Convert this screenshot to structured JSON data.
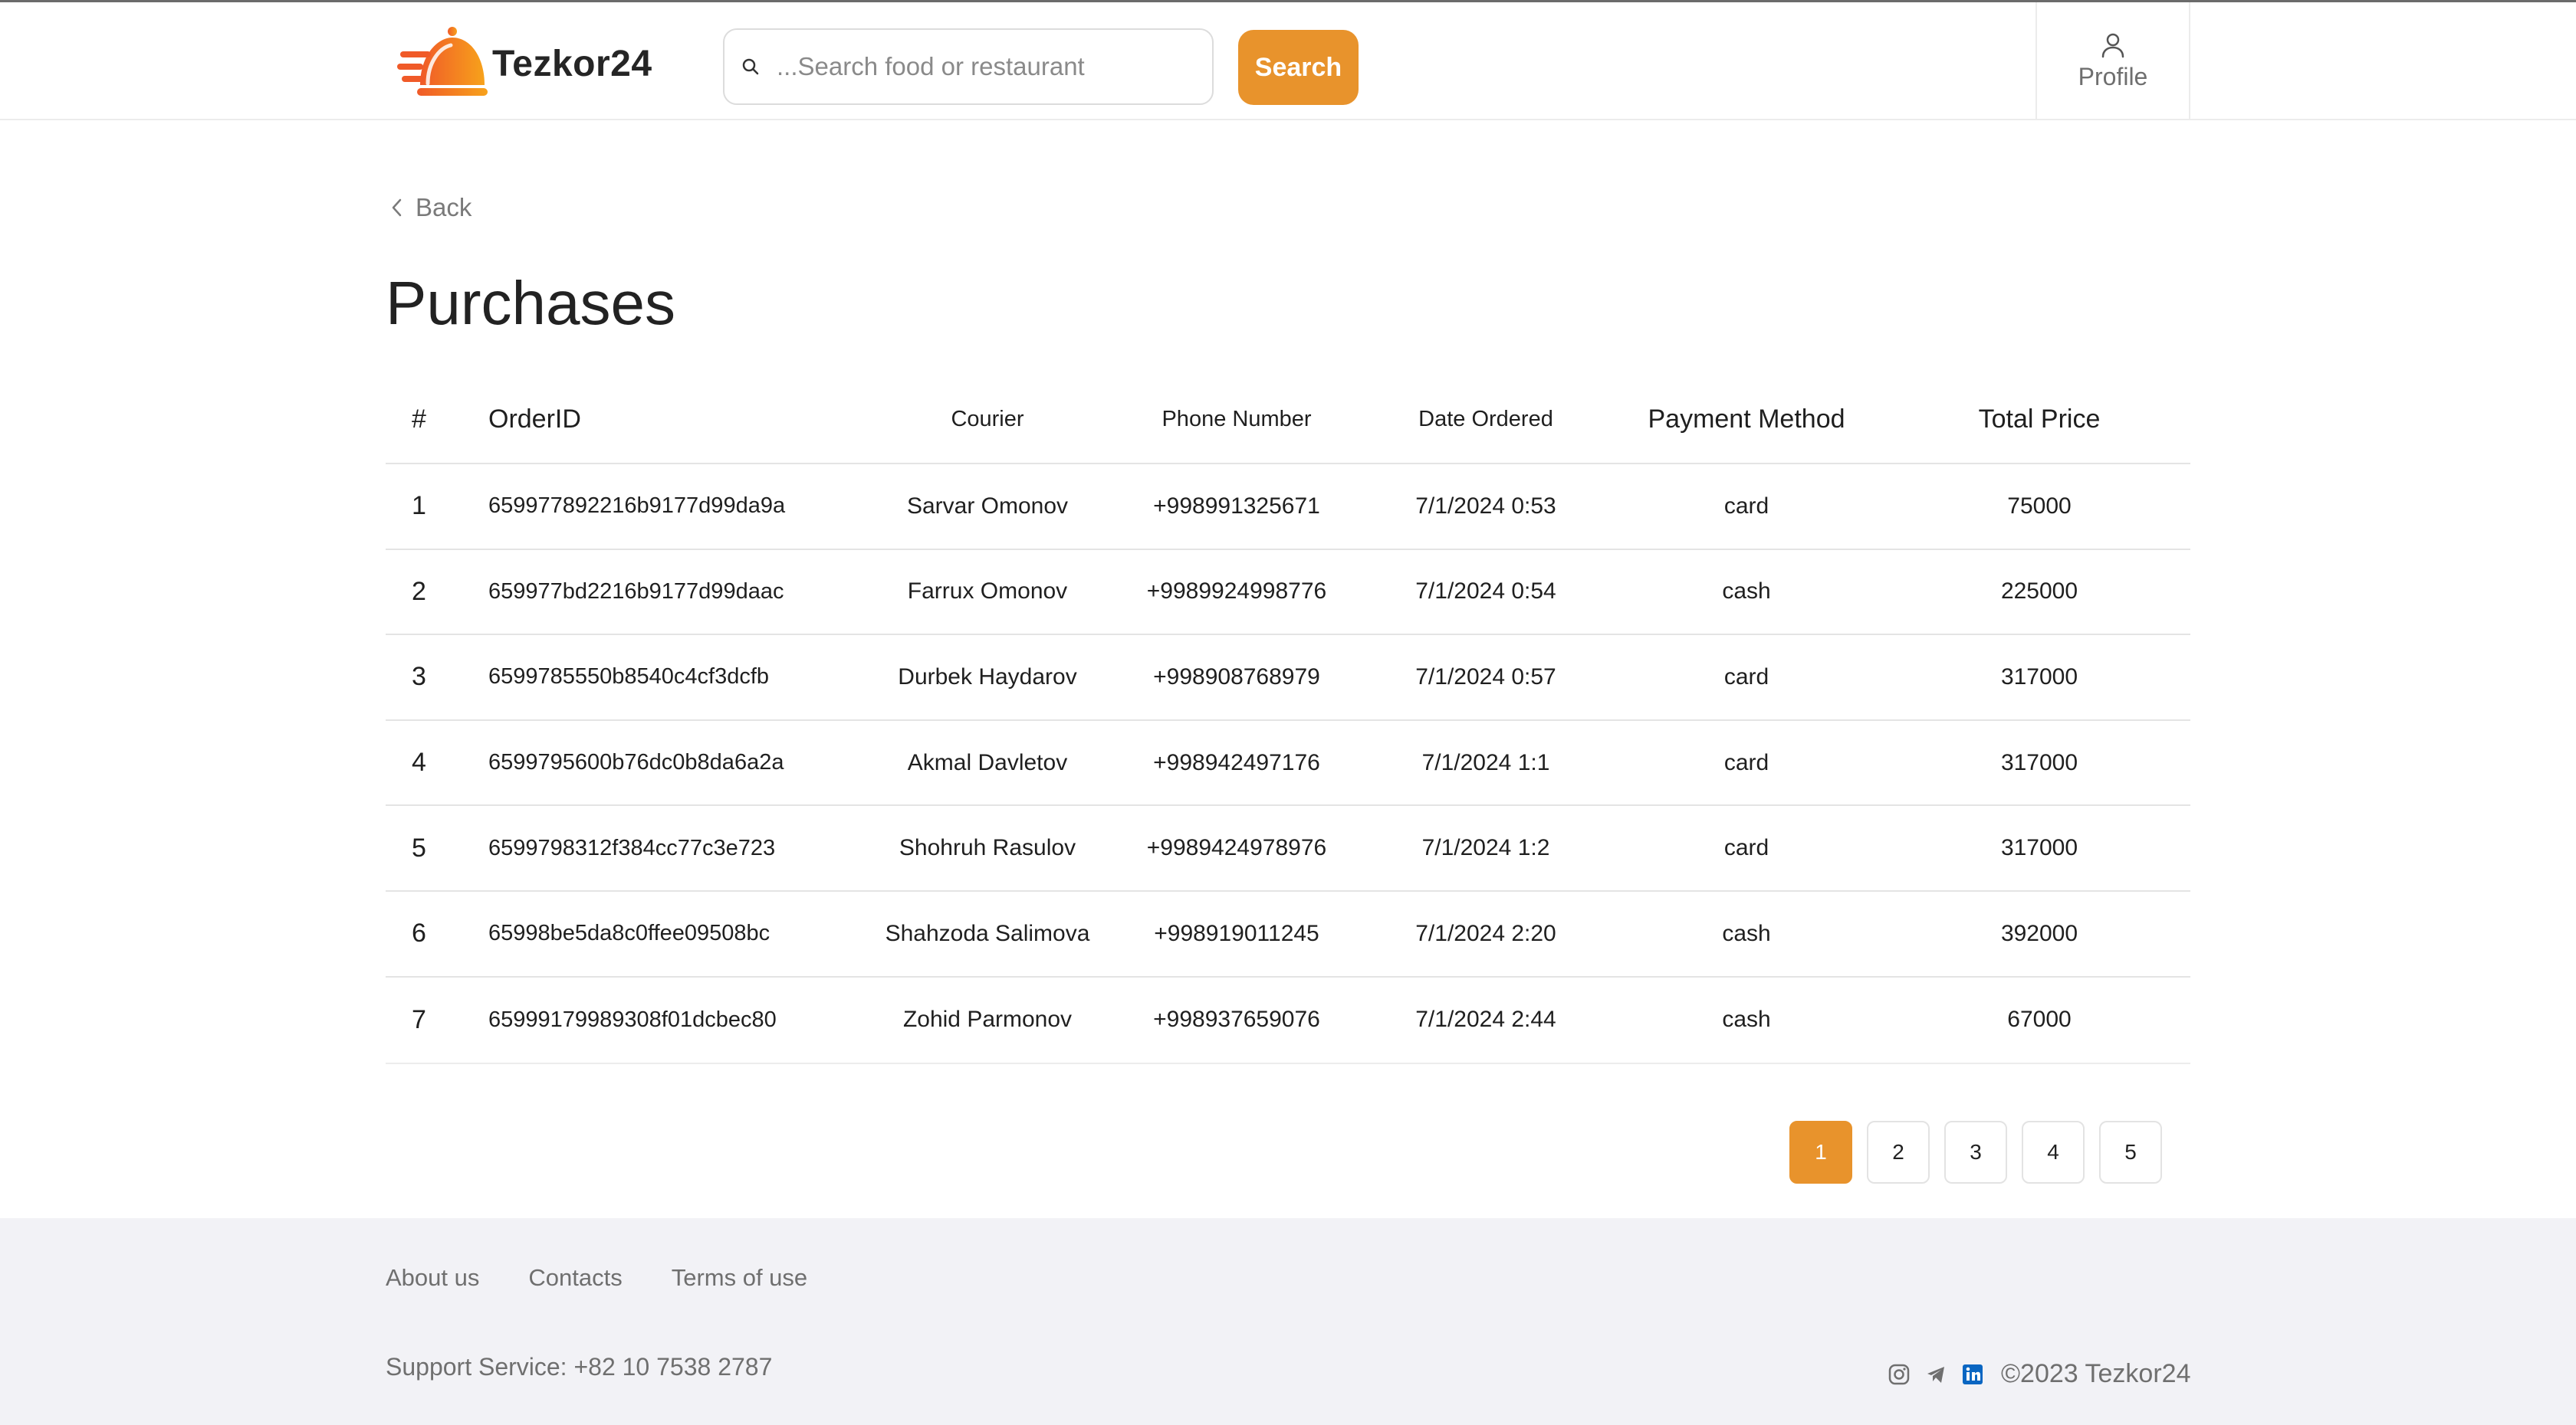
{
  "header": {
    "logo_text": "Tezkor24",
    "search_placeholder": "...Search food or restaurant",
    "search_button": "Search",
    "profile_label": "Profile"
  },
  "back_label": "Back",
  "page_title": "Purchases",
  "table": {
    "columns": [
      "#",
      "OrderID",
      "Courier",
      "Phone Number",
      "Date Ordered",
      "Payment Method",
      "Total Price"
    ],
    "rows": [
      {
        "num": "1",
        "order_id": "659977892216b9177d99da9a",
        "courier": "Sarvar Omonov",
        "phone": "+998991325671",
        "date": "7/1/2024 0:53",
        "payment": "card",
        "total": "75000"
      },
      {
        "num": "2",
        "order_id": "659977bd2216b9177d99daac",
        "courier": "Farrux Omonov",
        "phone": "+9989924998776",
        "date": "7/1/2024 0:54",
        "payment": "cash",
        "total": "225000"
      },
      {
        "num": "3",
        "order_id": "6599785550b8540c4cf3dcfb",
        "courier": "Durbek Haydarov",
        "phone": "+998908768979",
        "date": "7/1/2024 0:57",
        "payment": "card",
        "total": "317000"
      },
      {
        "num": "4",
        "order_id": "6599795600b76dc0b8da6a2a",
        "courier": "Akmal Davletov",
        "phone": "+998942497176",
        "date": "7/1/2024 1:1",
        "payment": "card",
        "total": "317000"
      },
      {
        "num": "5",
        "order_id": "6599798312f384cc77c3e723",
        "courier": "Shohruh Rasulov",
        "phone": "+9989424978976",
        "date": "7/1/2024 1:2",
        "payment": "card",
        "total": "317000"
      },
      {
        "num": "6",
        "order_id": "65998be5da8c0ffee09508bc",
        "courier": "Shahzoda Salimova",
        "phone": "+998919011245",
        "date": "7/1/2024 2:20",
        "payment": "cash",
        "total": "392000"
      },
      {
        "num": "7",
        "order_id": "65999179989308f01dcbec80",
        "courier": "Zohid Parmonov",
        "phone": "+998937659076",
        "date": "7/1/2024 2:44",
        "payment": "cash",
        "total": "67000"
      }
    ]
  },
  "pagination": {
    "pages": [
      "1",
      "2",
      "3",
      "4",
      "5"
    ],
    "current": "1"
  },
  "footer": {
    "links": [
      "About us",
      "Contacts",
      "Terms of use"
    ],
    "support": "Support Service: +82 10 7538 2787",
    "social_icons": [
      "instagram-icon",
      "telegram-icon",
      "linkedin-icon"
    ],
    "copyright": "©2023 Tezkor24"
  },
  "colors": {
    "accent": "#e8932c",
    "logo_gradient_start": "#f05a28",
    "logo_gradient_end": "#f7a21b",
    "linkedin": "#0a66c2",
    "footer_bg": "#f2f2f6"
  }
}
